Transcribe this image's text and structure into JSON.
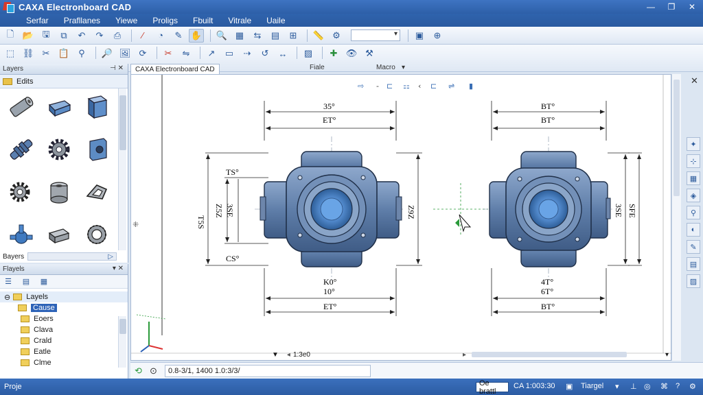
{
  "window": {
    "title": "CAXA Electronboard CAD"
  },
  "menu": [
    "Serfar",
    "Prafllanes",
    "Yiewe",
    "Proligs",
    "Fbuilt",
    "Vitrale",
    "Uaile"
  ],
  "toolbar_groups": {
    "file_label": "Fiale",
    "macro_label": "Macro"
  },
  "document_tab": "CAXA Electronboard CAD",
  "parts_panel": {
    "header": "Layers",
    "subheader": "Edits",
    "footer": "Bayers",
    "items": [
      "cylinder-part",
      "cube-part",
      "box-part",
      "shaft-part",
      "gear-part",
      "bracket-part",
      "gear-small-part",
      "bushing-part",
      "clamp-part",
      "valve-part",
      "block-part",
      "ring-part"
    ]
  },
  "layers_panel": {
    "header": "Flayels",
    "root": "Layels",
    "selected": "Cause",
    "children": [
      "Eoers",
      "Clava",
      "Crald",
      "Eatle",
      "Clme"
    ]
  },
  "drawing": {
    "left_view": {
      "top_dims": [
        "35°",
        "ET°"
      ],
      "bottom_dims": [
        "K0°",
        "10°",
        "ET°"
      ],
      "left_dims": [
        "T5S",
        "Z5Z",
        "TS°",
        "CS°"
      ],
      "inner_dims": [
        "3SE"
      ],
      "right_dims": [
        "Z9Z"
      ]
    },
    "right_view": {
      "top_dims": [
        "BT°",
        "BT°"
      ],
      "bottom_dims": [
        "4T°",
        "6T°",
        "BT°"
      ],
      "right_dims": [
        "3SE",
        "SFE"
      ]
    }
  },
  "canvas_footer": "1:3e0",
  "command_line": "0.8-3/1, 1400 1.0:3/3/",
  "status": {
    "left": "Proje",
    "mode": "Oe brattl",
    "coords": "CA 1:003:30",
    "snap": "Tiargel"
  }
}
